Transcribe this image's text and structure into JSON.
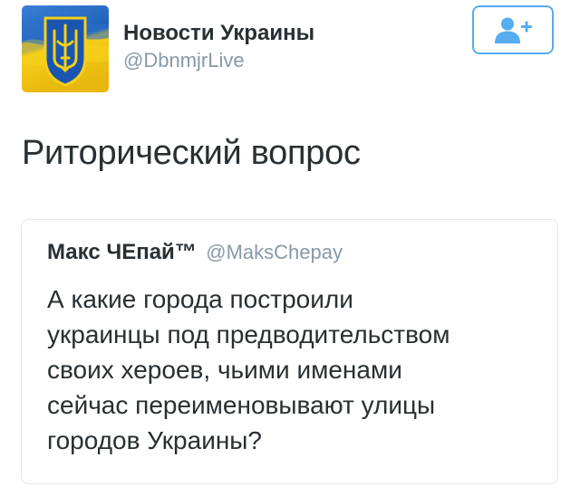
{
  "author": {
    "display_name": "Новости Украины",
    "handle": "@DbnmjrLive",
    "avatar_icon": "ukraine-coat-of-arms-flag-avatar"
  },
  "follow_button": {
    "icon": "add-user-icon"
  },
  "tweet": {
    "text": "Риторический вопрос"
  },
  "quoted_tweet": {
    "display_name": "Макс ЧЕпай™",
    "handle": "@MaksChepay",
    "text_lines": [
      "А какие города построили",
      "украинцы под предводительством",
      "своих хероев, чьими именами",
      "сейчас переименовывают улицы",
      "городов Украины?"
    ]
  },
  "colors": {
    "accent": "#55acee",
    "text": "#292f33",
    "secondary": "#8899a6",
    "border": "#e1e8ed",
    "flag_blue": "#1f5fb8",
    "flag_yellow": "#f5cf1a"
  }
}
